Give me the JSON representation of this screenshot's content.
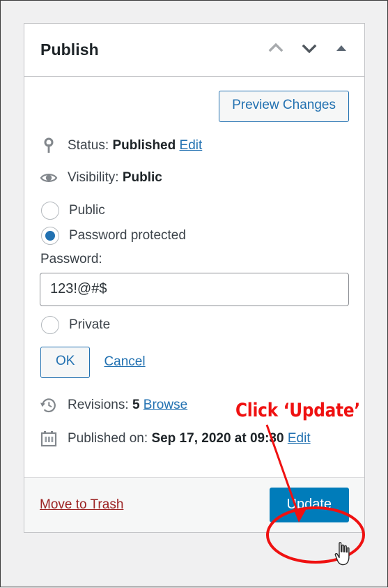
{
  "panel": {
    "title": "Publish",
    "header_icons": [
      {
        "name": "chevron-up-icon",
        "glyph": "order-up"
      },
      {
        "name": "chevron-down-icon",
        "glyph": "order-down"
      },
      {
        "name": "toggle-panel-icon",
        "glyph": "triangle-up"
      }
    ],
    "preview_button": "Preview Changes",
    "status": {
      "icon": "post-status-pin-icon",
      "label": "Status:",
      "value": "Published",
      "edit_link": "Edit"
    },
    "visibility": {
      "icon": "eye-icon",
      "label": "Visibility:",
      "value": "Public"
    },
    "visibility_options": [
      {
        "label": "Public",
        "selected": false
      },
      {
        "label": "Password protected",
        "selected": true
      },
      {
        "label": "Private",
        "selected": false
      }
    ],
    "password": {
      "label": "Password:",
      "value": "123!@#$",
      "placeholder": ""
    },
    "ok_button": "OK",
    "cancel_link": "Cancel",
    "revisions": {
      "icon": "revisions-clock-icon",
      "label": "Revisions:",
      "count": "5",
      "browse_link": "Browse"
    },
    "published_on": {
      "icon": "calendar-icon",
      "label": "Published on:",
      "value": "Sep 17, 2020 at 09:30",
      "edit_link": "Edit"
    },
    "footer": {
      "trash_link": "Move to Trash",
      "update_button": "Update"
    }
  },
  "annotation": {
    "callout_text": "Click ‘Update’",
    "arrow": "red-arrow-pointing-to-update-button",
    "highlight": "red-ellipse-around-update-button",
    "color": "#ef1111"
  },
  "cursor": {
    "type": "pointing-hand-cursor"
  },
  "colors": {
    "primary_blue": "#007cba",
    "link_blue": "#2271b1",
    "trash_red": "#9c2323",
    "annotation_red": "#ef1111",
    "panel_border": "#c3c4c7",
    "page_background": "#f0f0f1"
  }
}
